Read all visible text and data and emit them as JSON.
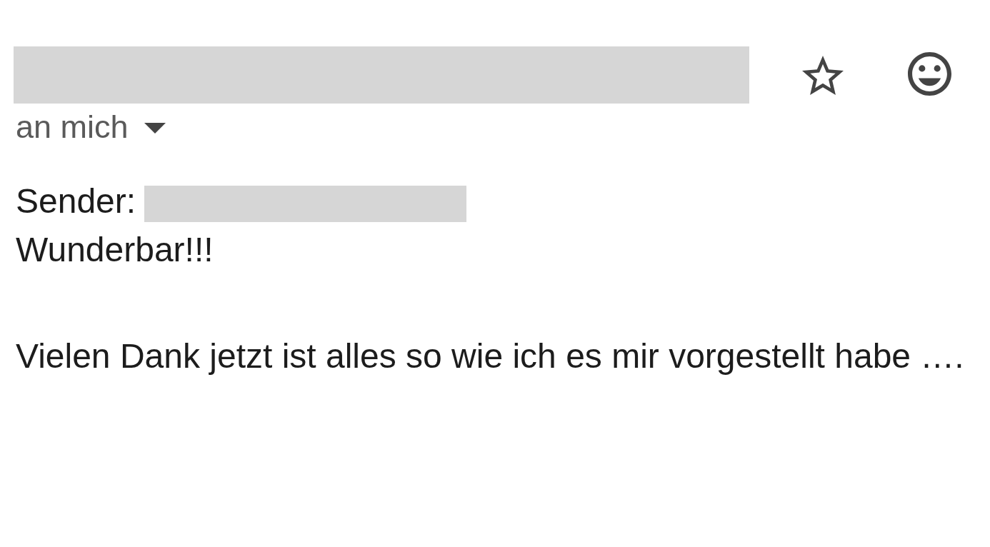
{
  "message_header": {
    "starred": false,
    "recipient_toggle": {
      "label": "an mich",
      "expanded": false
    }
  },
  "body": {
    "sender_label": "Sender:",
    "greeting": "Wunderbar!!!",
    "text": "Vielen Dank jetzt ist alles so wie ich es mir vorgestellt habe …."
  }
}
